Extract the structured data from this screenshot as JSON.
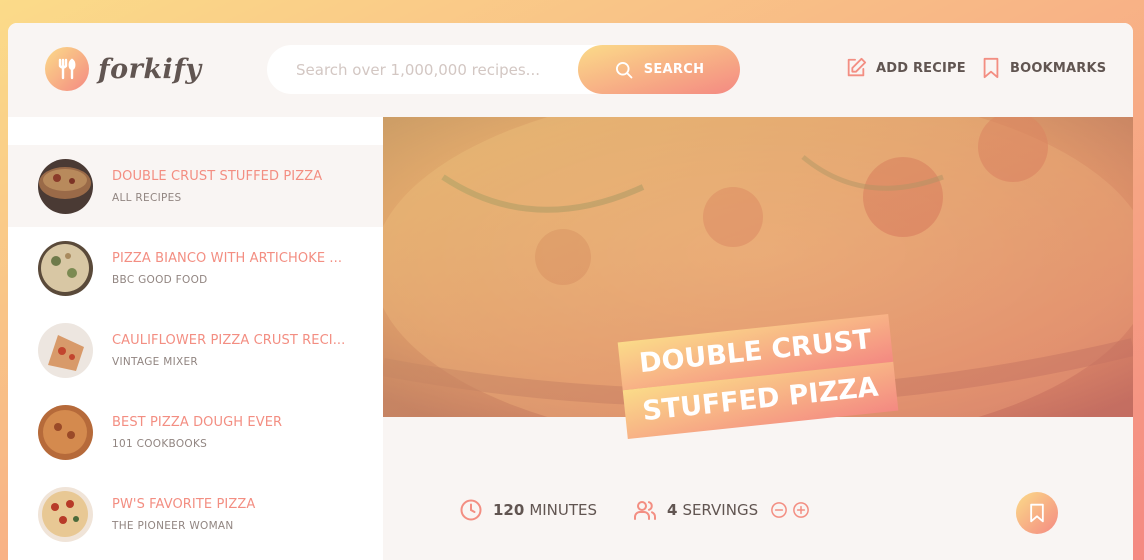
{
  "app": {
    "name": "forkify"
  },
  "header": {
    "logo_icon": "fork-spoon-icon",
    "search": {
      "placeholder": "Search over 1,000,000 recipes...",
      "value": "",
      "button_label": "SEARCH",
      "icon": "search-icon"
    },
    "nav": [
      {
        "label": "ADD RECIPE",
        "icon": "edit-icon"
      },
      {
        "label": "BOOKMARKS",
        "icon": "bookmark-icon"
      }
    ]
  },
  "results": [
    {
      "title": "DOUBLE CRUST STUFFED PIZZA",
      "publisher": "ALL RECIPES",
      "active": true
    },
    {
      "title": "PIZZA BIANCO WITH ARTICHOKE ...",
      "publisher": "BBC GOOD FOOD",
      "active": false
    },
    {
      "title": "CAULIFLOWER PIZZA CRUST RECI...",
      "publisher": "VINTAGE MIXER",
      "active": false
    },
    {
      "title": "BEST PIZZA DOUGH EVER",
      "publisher": "101 COOKBOOKS",
      "active": false
    },
    {
      "title": "PW'S FAVORITE PIZZA",
      "publisher": "THE PIONEER WOMAN",
      "active": false
    }
  ],
  "recipe": {
    "title_line1": "DOUBLE CRUST",
    "title_line2": "STUFFED PIZZA",
    "cooking_time": "120",
    "cooking_time_unit": "MINUTES",
    "servings": "4",
    "servings_unit": "SERVINGS",
    "icons": [
      "clock-icon",
      "users-icon",
      "minus-circle-icon",
      "plus-circle-icon",
      "bookmark-icon"
    ]
  },
  "colors": {
    "accent_start": "#fbdb89",
    "accent_end": "#f48982",
    "result_title": "#f38e82",
    "text_dark": "#615551",
    "background_light": "#f9f5f3"
  }
}
